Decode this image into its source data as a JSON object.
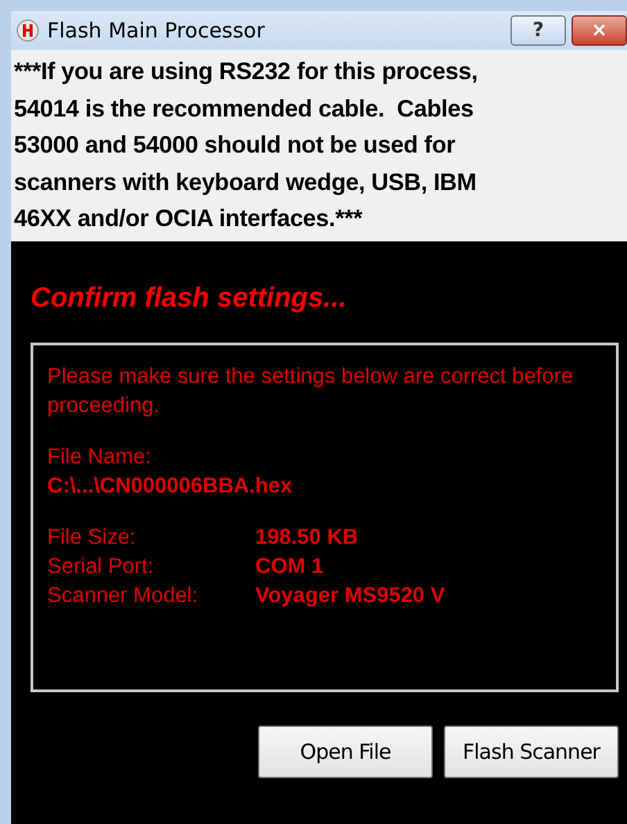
{
  "window": {
    "title": "Flash Main Processor",
    "buttons": [
      {
        "kind": "help",
        "label": "?"
      },
      {
        "kind": "close",
        "label": "×"
      }
    ]
  },
  "notice": "***If you are using RS232 for this process,\n54014 is the recommended cable.  Cables\n53000 and 54000 should not be used for\nscanners with keyboard wedge, USB, IBM\n46XX and/or OCIA interfaces.***",
  "heading": "Confirm flash settings...",
  "panel": {
    "intro": "Please make sure the settings below are correct before proceeding.",
    "file_label": "File Name:",
    "file_value": "C:\\...\\CN000006BBA.hex",
    "rows": [
      {
        "label": "File Size:",
        "value": "198.50 KB"
      },
      {
        "label": "Serial Port:",
        "value": "COM 1"
      },
      {
        "label": "Scanner Model:",
        "value": "Voyager MS9520 V"
      }
    ]
  },
  "buttons": [
    "Open File",
    "Flash Scanner"
  ]
}
